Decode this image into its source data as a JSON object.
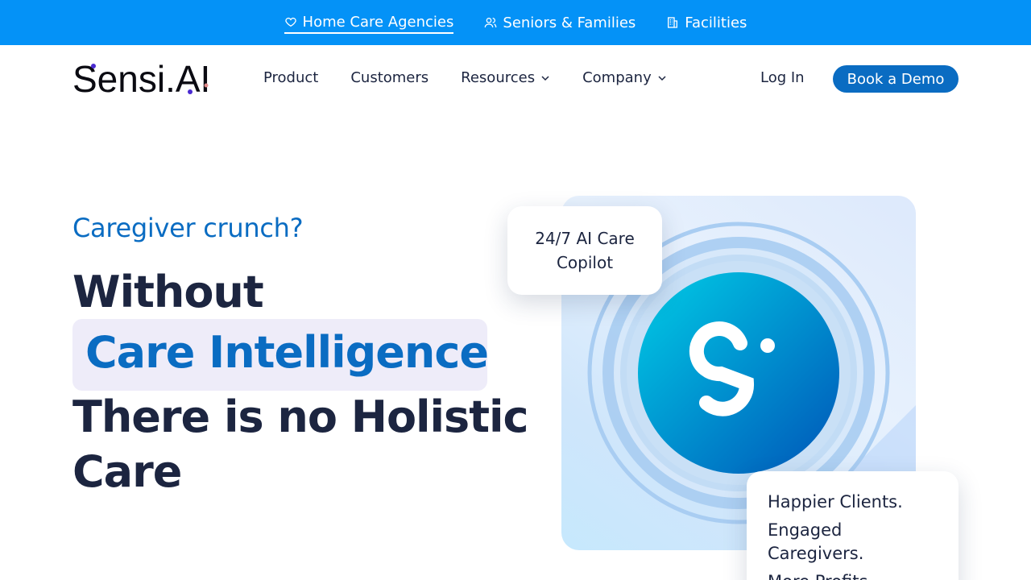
{
  "topbar": {
    "items": [
      {
        "label": "Home Care Agencies",
        "icon": "heart-icon",
        "active": true
      },
      {
        "label": "Seniors & Families",
        "icon": "users-icon",
        "active": false
      },
      {
        "label": "Facilities",
        "icon": "building-icon",
        "active": false
      }
    ],
    "bg_color": "#0492f7"
  },
  "header": {
    "logo_text": "Sensi.AI",
    "nav": [
      {
        "label": "Product"
      },
      {
        "label": "Customers"
      },
      {
        "label": "Resources"
      },
      {
        "label": "Company"
      }
    ],
    "login_label": "Log In",
    "demo_label": "Book a Demo",
    "accent_color": "#0a6cc2"
  },
  "hero": {
    "eyebrow": "Caregiver crunch?",
    "line1": "Without",
    "highlight": "Care Intelligence",
    "line3": "There is no Holistic",
    "line4": "Care"
  },
  "visual": {
    "callout_top_line1": "24/7 AI Care",
    "callout_top_line2": "Copilot",
    "callout_bottom": [
      "Happier Clients.",
      "Engaged Caregivers.",
      "More Profits."
    ]
  }
}
